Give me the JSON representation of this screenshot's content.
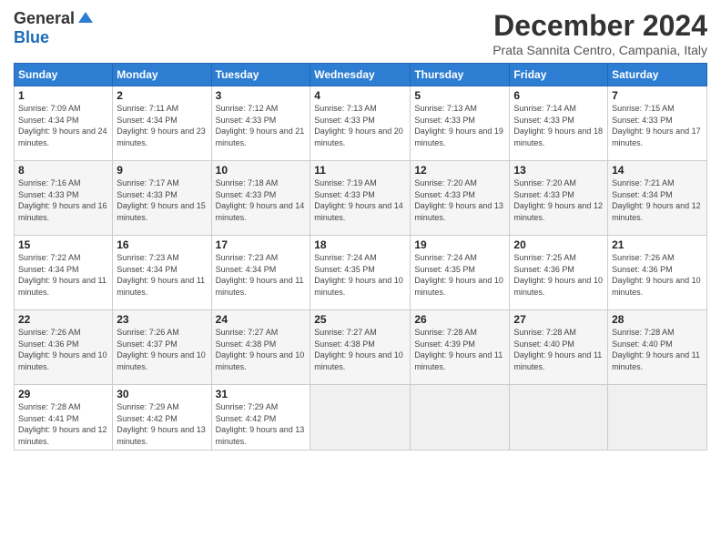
{
  "logo": {
    "general": "General",
    "blue": "Blue"
  },
  "title": "December 2024",
  "subtitle": "Prata Sannita Centro, Campania, Italy",
  "days_of_week": [
    "Sunday",
    "Monday",
    "Tuesday",
    "Wednesday",
    "Thursday",
    "Friday",
    "Saturday"
  ],
  "weeks": [
    [
      {
        "day": "1",
        "sunrise": "7:09 AM",
        "sunset": "4:34 PM",
        "daylight": "9 hours and 24 minutes."
      },
      {
        "day": "2",
        "sunrise": "7:11 AM",
        "sunset": "4:34 PM",
        "daylight": "9 hours and 23 minutes."
      },
      {
        "day": "3",
        "sunrise": "7:12 AM",
        "sunset": "4:33 PM",
        "daylight": "9 hours and 21 minutes."
      },
      {
        "day": "4",
        "sunrise": "7:13 AM",
        "sunset": "4:33 PM",
        "daylight": "9 hours and 20 minutes."
      },
      {
        "day": "5",
        "sunrise": "7:13 AM",
        "sunset": "4:33 PM",
        "daylight": "9 hours and 19 minutes."
      },
      {
        "day": "6",
        "sunrise": "7:14 AM",
        "sunset": "4:33 PM",
        "daylight": "9 hours and 18 minutes."
      },
      {
        "day": "7",
        "sunrise": "7:15 AM",
        "sunset": "4:33 PM",
        "daylight": "9 hours and 17 minutes."
      }
    ],
    [
      {
        "day": "8",
        "sunrise": "7:16 AM",
        "sunset": "4:33 PM",
        "daylight": "9 hours and 16 minutes."
      },
      {
        "day": "9",
        "sunrise": "7:17 AM",
        "sunset": "4:33 PM",
        "daylight": "9 hours and 15 minutes."
      },
      {
        "day": "10",
        "sunrise": "7:18 AM",
        "sunset": "4:33 PM",
        "daylight": "9 hours and 14 minutes."
      },
      {
        "day": "11",
        "sunrise": "7:19 AM",
        "sunset": "4:33 PM",
        "daylight": "9 hours and 14 minutes."
      },
      {
        "day": "12",
        "sunrise": "7:20 AM",
        "sunset": "4:33 PM",
        "daylight": "9 hours and 13 minutes."
      },
      {
        "day": "13",
        "sunrise": "7:20 AM",
        "sunset": "4:33 PM",
        "daylight": "9 hours and 12 minutes."
      },
      {
        "day": "14",
        "sunrise": "7:21 AM",
        "sunset": "4:34 PM",
        "daylight": "9 hours and 12 minutes."
      }
    ],
    [
      {
        "day": "15",
        "sunrise": "7:22 AM",
        "sunset": "4:34 PM",
        "daylight": "9 hours and 11 minutes."
      },
      {
        "day": "16",
        "sunrise": "7:23 AM",
        "sunset": "4:34 PM",
        "daylight": "9 hours and 11 minutes."
      },
      {
        "day": "17",
        "sunrise": "7:23 AM",
        "sunset": "4:34 PM",
        "daylight": "9 hours and 11 minutes."
      },
      {
        "day": "18",
        "sunrise": "7:24 AM",
        "sunset": "4:35 PM",
        "daylight": "9 hours and 10 minutes."
      },
      {
        "day": "19",
        "sunrise": "7:24 AM",
        "sunset": "4:35 PM",
        "daylight": "9 hours and 10 minutes."
      },
      {
        "day": "20",
        "sunrise": "7:25 AM",
        "sunset": "4:36 PM",
        "daylight": "9 hours and 10 minutes."
      },
      {
        "day": "21",
        "sunrise": "7:26 AM",
        "sunset": "4:36 PM",
        "daylight": "9 hours and 10 minutes."
      }
    ],
    [
      {
        "day": "22",
        "sunrise": "7:26 AM",
        "sunset": "4:36 PM",
        "daylight": "9 hours and 10 minutes."
      },
      {
        "day": "23",
        "sunrise": "7:26 AM",
        "sunset": "4:37 PM",
        "daylight": "9 hours and 10 minutes."
      },
      {
        "day": "24",
        "sunrise": "7:27 AM",
        "sunset": "4:38 PM",
        "daylight": "9 hours and 10 minutes."
      },
      {
        "day": "25",
        "sunrise": "7:27 AM",
        "sunset": "4:38 PM",
        "daylight": "9 hours and 10 minutes."
      },
      {
        "day": "26",
        "sunrise": "7:28 AM",
        "sunset": "4:39 PM",
        "daylight": "9 hours and 11 minutes."
      },
      {
        "day": "27",
        "sunrise": "7:28 AM",
        "sunset": "4:40 PM",
        "daylight": "9 hours and 11 minutes."
      },
      {
        "day": "28",
        "sunrise": "7:28 AM",
        "sunset": "4:40 PM",
        "daylight": "9 hours and 11 minutes."
      }
    ],
    [
      {
        "day": "29",
        "sunrise": "7:28 AM",
        "sunset": "4:41 PM",
        "daylight": "9 hours and 12 minutes."
      },
      {
        "day": "30",
        "sunrise": "7:29 AM",
        "sunset": "4:42 PM",
        "daylight": "9 hours and 13 minutes."
      },
      {
        "day": "31",
        "sunrise": "7:29 AM",
        "sunset": "4:42 PM",
        "daylight": "9 hours and 13 minutes."
      },
      null,
      null,
      null,
      null
    ]
  ]
}
